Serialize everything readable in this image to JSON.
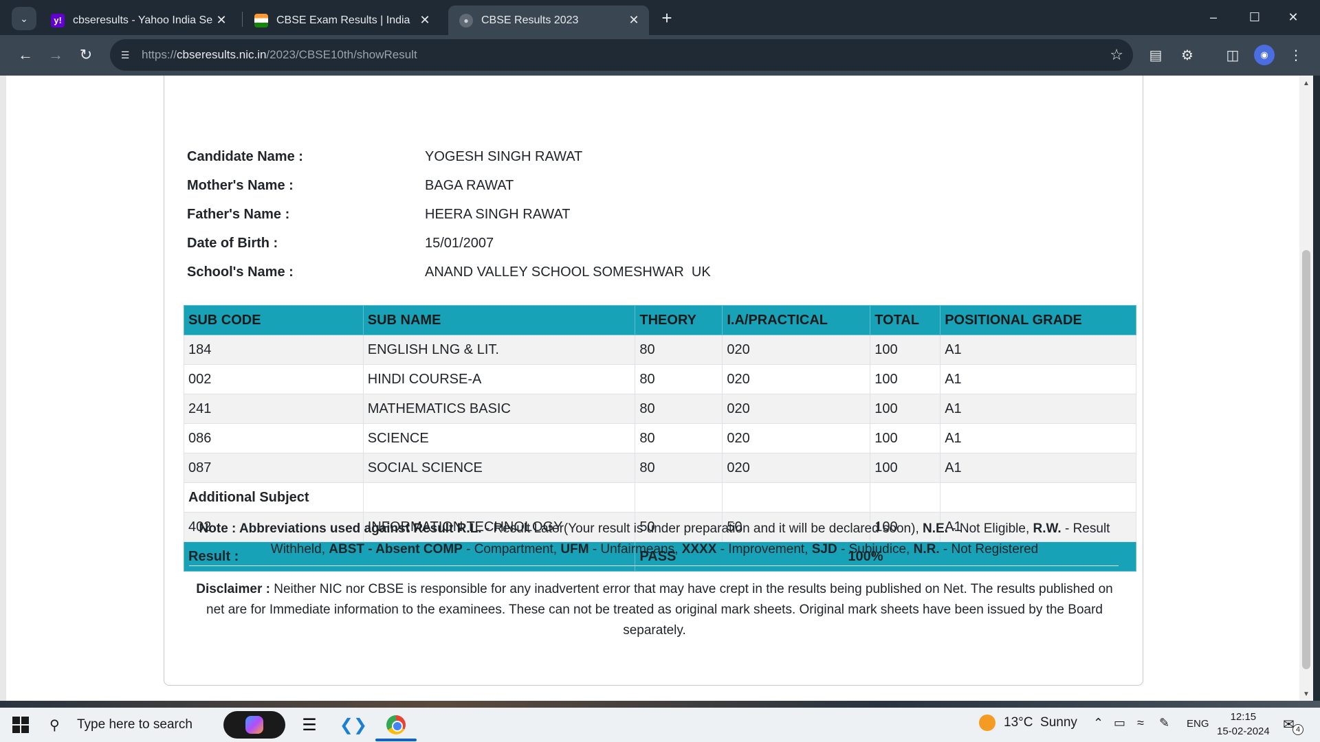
{
  "browser": {
    "tabs": [
      {
        "title": "cbseresults - Yahoo India Search",
        "favicon": "yahoo-icon",
        "favicon_color": "#6001d2"
      },
      {
        "title": "CBSE Exam Results | India",
        "favicon": "india-flag-icon"
      },
      {
        "title": "CBSE Results 2023",
        "favicon": "globe-icon",
        "active": true
      }
    ],
    "url_prefix": "https://",
    "url_domain": "cbseresults.nic.in",
    "url_path": "/2023/CBSE10th/showResult"
  },
  "candidate": {
    "name_label": "Candidate Name :",
    "name": "YOGESH SINGH RAWAT",
    "mother_label": "Mother's Name :",
    "mother": "BAGA RAWAT",
    "father_label": "Father's Name :",
    "father": "HEERA SINGH RAWAT",
    "dob_label": "Date of Birth :",
    "dob": "15/01/2007",
    "school_label": "School's Name :",
    "school": "ANAND VALLEY SCHOOL SOMESHWAR  UK"
  },
  "table": {
    "headers": [
      "SUB CODE",
      "SUB NAME",
      "THEORY",
      "I.A/PRACTICAL",
      "TOTAL",
      "POSITIONAL GRADE"
    ],
    "rows": [
      [
        "184",
        "ENGLISH LNG & LIT.",
        "80",
        "020",
        "100",
        "A1"
      ],
      [
        "002",
        "HINDI COURSE-A",
        "80",
        "020",
        "100",
        "A1"
      ],
      [
        "241",
        "MATHEMATICS BASIC",
        "80",
        "020",
        "100",
        "A1"
      ],
      [
        "086",
        "SCIENCE",
        "80",
        "020",
        "100",
        "A1"
      ],
      [
        "087",
        "SOCIAL SCIENCE",
        "80",
        "020",
        "100",
        "A1"
      ]
    ],
    "additional_label": "Additional Subject",
    "additional_row": [
      "402",
      "INFORMATION TECHNOLOGY",
      "50",
      "50",
      "100",
      "A1"
    ],
    "result_label": "Result :",
    "result_value": "PASS",
    "result_percent": "100%",
    "header_color": "#17a2b8"
  },
  "note": {
    "lead": "Note : Abbreviations used against Result",
    "rl": "R.L.",
    "rl_text": "- Result Later(Your result is under preparation and it will be declared soon),",
    "ne": "N.E.",
    "ne_text": "- Not Eligible,",
    "rw": "R.W.",
    "rw_text": "- Result Withheld,",
    "abst": "ABST - Absent COMP",
    "comp_text": "- Compartment,",
    "ufm": "UFM",
    "ufm_text": "- Unfairmeans,",
    "xxxx": "XXXX",
    "xxxx_text": "- Improvement,",
    "sjd": "SJD",
    "sjd_text": "- Subjudice,",
    "nr": "N.R.",
    "nr_text": "- Not Registered"
  },
  "disclaimer": {
    "label": "Disclaimer :",
    "text": "Neither NIC nor CBSE is responsible for any inadvertent error that may have crept in the results being published on Net. The results published on net are for Immediate information to the examinees. These can not be treated as original mark sheets. Original mark sheets have been issued by the Board separately."
  },
  "taskbar": {
    "search_placeholder": "Type here to search",
    "weather_temp": "13°C",
    "weather_desc": "Sunny",
    "lang": "ENG",
    "time": "12:15",
    "date": "15-02-2024",
    "notification_count": "4"
  }
}
